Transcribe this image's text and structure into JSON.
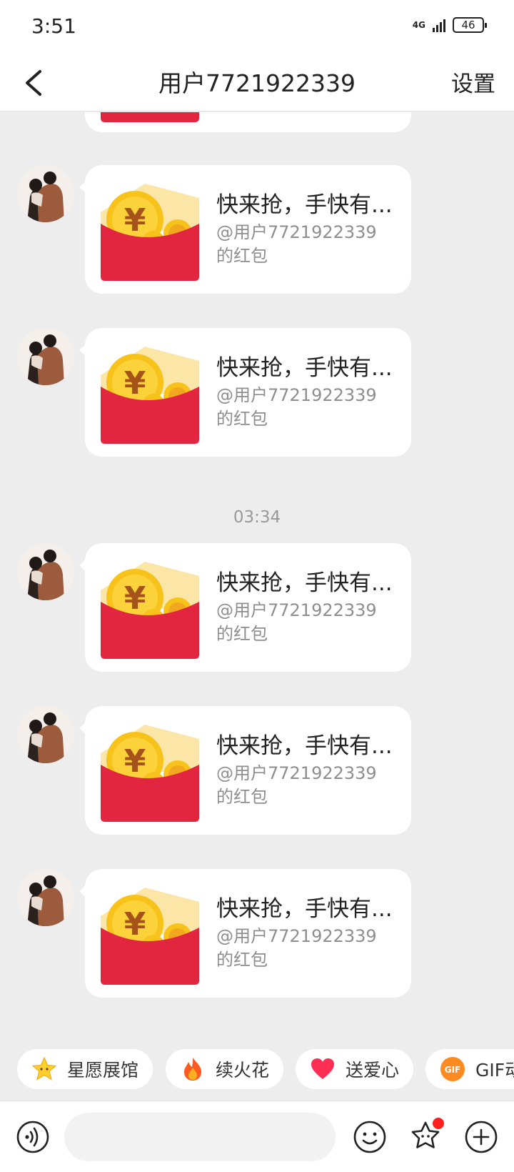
{
  "status_bar": {
    "time": "3:51",
    "network": "4G",
    "battery": "46"
  },
  "nav": {
    "title": "用户7721922339",
    "settings_label": "设置"
  },
  "messages": [
    {
      "title": "快来抢，手快有...",
      "subtitle": "@用户7721922339 的红包"
    },
    {
      "title": "快来抢，手快有...",
      "subtitle": "@用户7721922339 的红包"
    },
    {
      "title": "快来抢，手快有...",
      "subtitle": "@用户7721922339 的红包"
    },
    {
      "title": "快来抢，手快有...",
      "subtitle": "@用户7721922339 的红包"
    },
    {
      "title": "快来抢，手快有...",
      "subtitle": "@用户7721922339 的红包"
    }
  ],
  "timestamp": "03:34",
  "quick_actions": [
    {
      "label": "星愿展馆",
      "icon": "star-face-icon"
    },
    {
      "label": "续火花",
      "icon": "flame-icon"
    },
    {
      "label": "送爱心",
      "icon": "heart-icon"
    },
    {
      "label": "GIF动图",
      "icon": "gif-icon"
    }
  ],
  "input": {
    "placeholder": ""
  },
  "colors": {
    "envelope_red": "#e3263f",
    "coin_gold": "#f7c21a",
    "badge_red": "#ff1f1f"
  }
}
